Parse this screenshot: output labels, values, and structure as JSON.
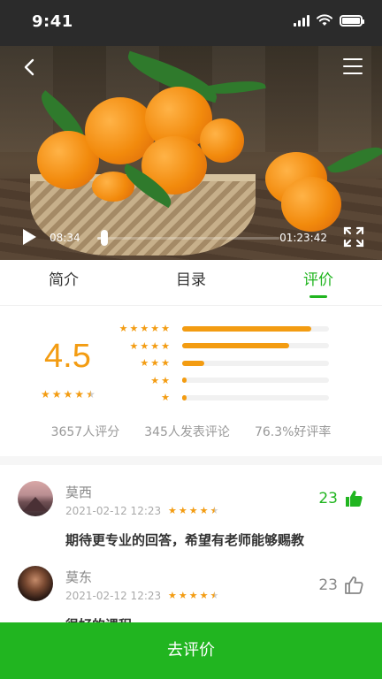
{
  "status_bar": {
    "time": "9:41"
  },
  "video": {
    "current_time": "08:34",
    "total_time": "01:23:42",
    "progress": 0.04
  },
  "tabs": [
    {
      "label": "简介",
      "active": false
    },
    {
      "label": "目录",
      "active": false
    },
    {
      "label": "评价",
      "active": true
    }
  ],
  "rating": {
    "score": "4.5",
    "stars": 4.5,
    "distribution": [
      {
        "stars": 5,
        "fraction": 0.88
      },
      {
        "stars": 4,
        "fraction": 0.73
      },
      {
        "stars": 3,
        "fraction": 0.15
      },
      {
        "stars": 2,
        "fraction": 0.03
      },
      {
        "stars": 1,
        "fraction": 0.03
      }
    ],
    "stats": {
      "ratings_count": "3657人评分",
      "reviews_count": "345人发表评论",
      "positive_rate": "76.3%好评率"
    }
  },
  "comments": [
    {
      "name": "莫西",
      "date": "2021-02-12 12:23",
      "stars": 4.5,
      "likes": "23",
      "liked": true,
      "text": "期待更专业的回答，希望有老师能够赐教"
    },
    {
      "name": "莫东",
      "date": "2021-02-12 12:23",
      "stars": 4.5,
      "likes": "23",
      "liked": false,
      "text": "很好的课程"
    }
  ],
  "cta": {
    "label": "去评价"
  },
  "colors": {
    "accent_green": "#21b520",
    "star_orange": "#f39c12"
  },
  "icons": [
    "back-icon",
    "menu-icon",
    "play-icon",
    "fullscreen-icon",
    "thumbs-up-icon",
    "star-icon"
  ]
}
